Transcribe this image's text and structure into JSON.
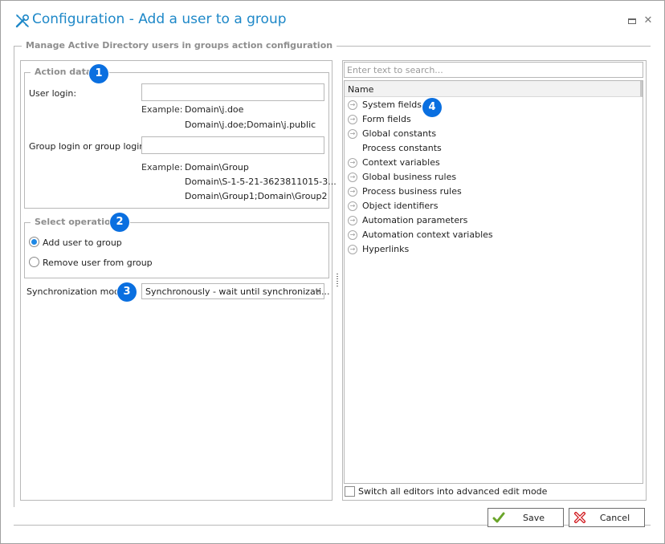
{
  "window": {
    "title": "Configuration - Add a user to a group",
    "title_icon": "tools-icon",
    "controls": {
      "maximize": "maximize-icon",
      "close": "✕"
    }
  },
  "outer_group": {
    "legend": "Manage Active Directory users in groups action configuration"
  },
  "action_data": {
    "legend": "Action data",
    "badge": "1",
    "user_login": {
      "label": "User login:",
      "value": "",
      "example_label": "Example:",
      "examples": [
        "Domain\\j.doe",
        "Domain\\j.doe;Domain\\j.public"
      ]
    },
    "group_login": {
      "label": "Group login or group logins:",
      "value": "",
      "example_label": "Example:",
      "examples": [
        "Domain\\Group",
        "Domain\\S-1-5-21-3623811015-3...",
        "Domain\\Group1;Domain\\Group2"
      ]
    }
  },
  "select_operation": {
    "legend": "Select operation",
    "badge": "2",
    "options": [
      {
        "label": "Add user to group",
        "checked": true
      },
      {
        "label": "Remove user from group",
        "checked": false
      }
    ]
  },
  "sync_mode": {
    "label": "Synchronization mode:",
    "badge": "3",
    "selected": "Synchronously - wait until synchronizati..."
  },
  "right_panel": {
    "search_placeholder": "Enter text to search...",
    "column_header": "Name",
    "badge": "4",
    "items": [
      {
        "label": "System fields",
        "expandable": true
      },
      {
        "label": "Form fields",
        "expandable": true
      },
      {
        "label": "Global constants",
        "expandable": true
      },
      {
        "label": "Process constants",
        "expandable": false
      },
      {
        "label": "Context variables",
        "expandable": true
      },
      {
        "label": "Global business rules",
        "expandable": true
      },
      {
        "label": "Process business rules",
        "expandable": true
      },
      {
        "label": "Object identifiers",
        "expandable": true
      },
      {
        "label": "Automation parameters",
        "expandable": true
      },
      {
        "label": "Automation context variables",
        "expandable": true
      },
      {
        "label": "Hyperlinks",
        "expandable": true
      }
    ],
    "advanced_mode": {
      "label": "Switch all editors into advanced edit mode",
      "checked": false
    }
  },
  "footer": {
    "save_label": "Save",
    "cancel_label": "Cancel"
  },
  "colors": {
    "title": "#1e88c8",
    "badge": "#0a6fe0",
    "radio_selected": "#1e88e5",
    "save_icon": "#6aa52a",
    "cancel_icon": "#d0161b"
  }
}
